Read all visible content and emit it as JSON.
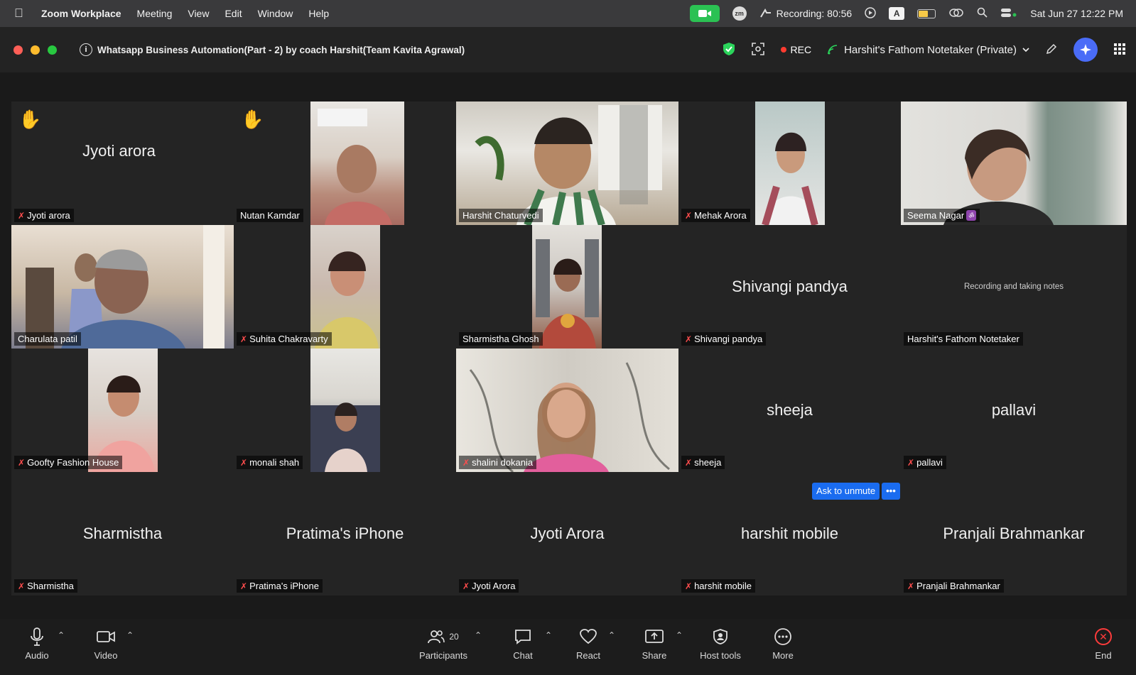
{
  "menubar": {
    "app": "Zoom Workplace",
    "menus": [
      "Meeting",
      "View",
      "Edit",
      "Window",
      "Help"
    ],
    "recording": "Recording: 80:56",
    "a_label": "A",
    "zm_label": "zm",
    "datetime": "Sat Jun 27  12:22 PM"
  },
  "titlebar": {
    "info_glyph": "i",
    "meeting_title": "Whatsapp Business Automation(Part - 2) by coach Harshit(Team Kavita Agrawal)",
    "rec": "REC",
    "notetaker": "Harshit's Fathom Notetaker (Private)"
  },
  "tiles": {
    "t1": {
      "center": "Jyoti arora",
      "name": "Jyoti arora"
    },
    "t2": {
      "name": "Nutan Kamdar"
    },
    "t3": {
      "name": "Harshit Chaturvedi"
    },
    "t4": {
      "name": "Mehak Arora"
    },
    "t5": {
      "name": "Seema Nagar",
      "badge": "ॐ"
    },
    "t6": {
      "name": "Charulata patil"
    },
    "t7": {
      "name": "Suhita Chakravarty"
    },
    "t8": {
      "name": "Sharmistha Ghosh"
    },
    "t9": {
      "center": "Shivangi pandya",
      "name": "Shivangi pandya"
    },
    "t10": {
      "note": "Recording and taking notes",
      "name": "Harshit's Fathom Notetaker"
    },
    "t11": {
      "name": "Goofty Fashion House"
    },
    "t12": {
      "name": "monali shah"
    },
    "t13": {
      "name": "shalini dokania"
    },
    "t14": {
      "center": "sheeja",
      "name": "sheeja"
    },
    "t15": {
      "center": "pallavi",
      "name": "pallavi"
    },
    "t16": {
      "center": "Sharmistha",
      "name": "Sharmistha"
    },
    "t17": {
      "center": "Pratima's iPhone",
      "name": "Pratima's iPhone"
    },
    "t18": {
      "center": "Jyoti Arora",
      "name": "Jyoti Arora"
    },
    "t19": {
      "center": "harshit mobile",
      "name": "harshit mobile"
    },
    "t20": {
      "center": "Pranjali Brahmankar",
      "name": "Pranjali Brahmankar"
    }
  },
  "ask_unmute": {
    "label": "Ask to unmute",
    "more": "•••"
  },
  "toolbar": {
    "audio": "Audio",
    "video": "Video",
    "participants": "Participants",
    "participant_count": "20",
    "chat": "Chat",
    "react": "React",
    "share": "Share",
    "host_tools": "Host tools",
    "more": "More",
    "end": "End"
  },
  "colors": {
    "active_speaker": "#2bd45b",
    "camera_pill": "#2bc153",
    "mute_red": "#ff4d4d",
    "ask_unmute_blue": "#1a6cf0"
  }
}
